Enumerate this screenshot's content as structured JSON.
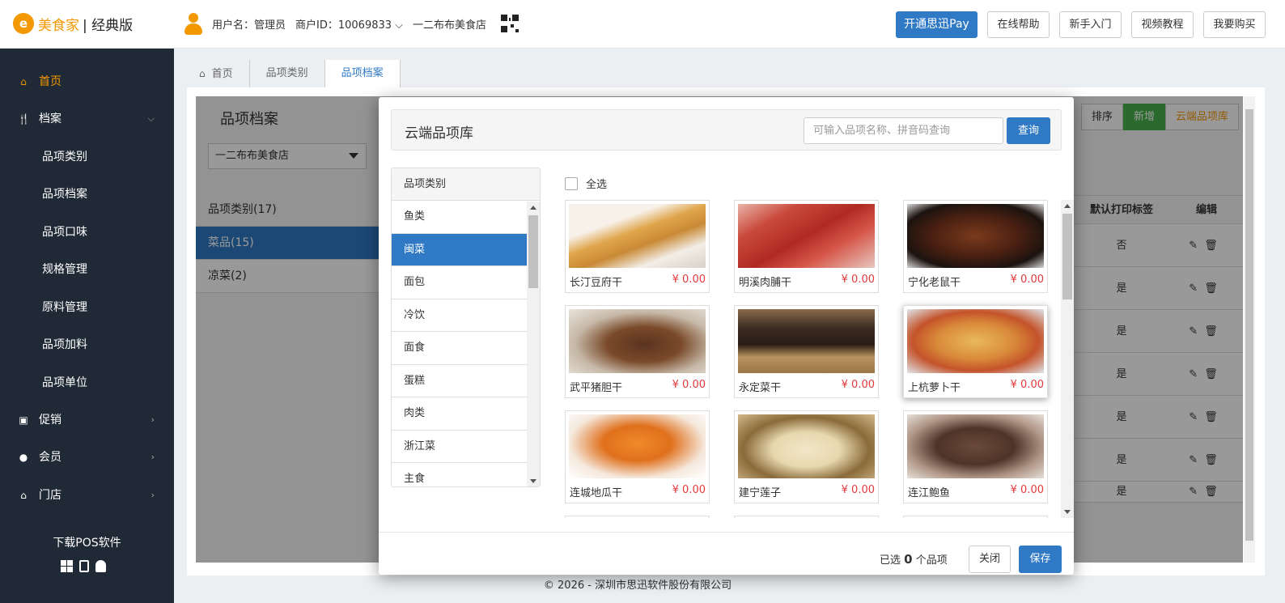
{
  "header": {
    "logo_glyph": "e",
    "brand": "美食家",
    "edition": "| 经典版",
    "username": "用户名：管理员",
    "merchant": "商户ID：10069833 ⌵",
    "store": "一二布布美食店",
    "buttons": [
      "开通思迅Pay",
      "在线帮助",
      "新手入门",
      "视频教程",
      "我要购买"
    ]
  },
  "sidebar": {
    "items": [
      {
        "label": "首页",
        "icon": "home-icon",
        "active": true
      },
      {
        "label": "档案",
        "icon": "cutlery-icon",
        "arrow": "⌵"
      },
      {
        "label": "品项类别",
        "sub": true
      },
      {
        "label": "品项档案",
        "sub": true
      },
      {
        "label": "品项口味",
        "sub": true
      },
      {
        "label": "规格管理",
        "sub": true
      },
      {
        "label": "原料管理",
        "sub": true
      },
      {
        "label": "品项加料",
        "sub": true
      },
      {
        "label": "品项单位",
        "sub": true
      },
      {
        "label": "促销",
        "icon": "gift-icon",
        "arrow": "›"
      },
      {
        "label": "会员",
        "icon": "users-icon",
        "arrow": "›"
      },
      {
        "label": "门店",
        "icon": "bank-icon",
        "arrow": "›"
      }
    ],
    "download": "下载POS软件"
  },
  "tabs": [
    {
      "label": "首页",
      "icon": "home-icon"
    },
    {
      "label": "品项类别"
    },
    {
      "label": "品项档案",
      "active": true
    }
  ],
  "page": {
    "title": "品项档案",
    "store_select": "一二布布美食店",
    "categories": [
      {
        "label": "品项类别(17)"
      },
      {
        "label": "菜品(15)",
        "active": true
      },
      {
        "label": "凉菜(2)"
      }
    ],
    "right_buttons": [
      "排序",
      "新增",
      "云端品项库"
    ],
    "table": {
      "headers": [
        "默认打印标签",
        "编辑"
      ],
      "rows": [
        "否",
        "是",
        "是",
        "是",
        "是",
        "是",
        "是"
      ]
    }
  },
  "modal": {
    "title": "云端品项库",
    "search_placeholder": "可输入品项名称、拼音码查询",
    "search_button": "查询",
    "category_header": "品项类别",
    "categories": [
      "鱼类",
      "闽菜",
      "面包",
      "冷饮",
      "面食",
      "蛋糕",
      "肉类",
      "浙江菜",
      "主食"
    ],
    "active_category": "闽菜",
    "select_all": "全选",
    "items": [
      {
        "name": "长汀豆府干",
        "price": "¥ 0.00"
      },
      {
        "name": "明溪肉脯干",
        "price": "¥ 0.00"
      },
      {
        "name": "宁化老鼠干",
        "price": "¥ 0.00"
      },
      {
        "name": "武平猪胆干",
        "price": "¥ 0.00"
      },
      {
        "name": "永定菜干",
        "price": "¥ 0.00"
      },
      {
        "name": "上杭萝卜干",
        "price": "¥ 0.00"
      },
      {
        "name": "连城地瓜干",
        "price": "¥ 0.00"
      },
      {
        "name": "建宁莲子",
        "price": "¥ 0.00"
      },
      {
        "name": "连江鲍鱼",
        "price": "¥ 0.00"
      }
    ],
    "selected_prefix": "已选",
    "selected_count": "0",
    "selected_suffix": "个品项",
    "close_button": "关闭",
    "save_button": "保存"
  },
  "footer": "© 2026 - 深圳市思迅软件股份有限公司"
}
